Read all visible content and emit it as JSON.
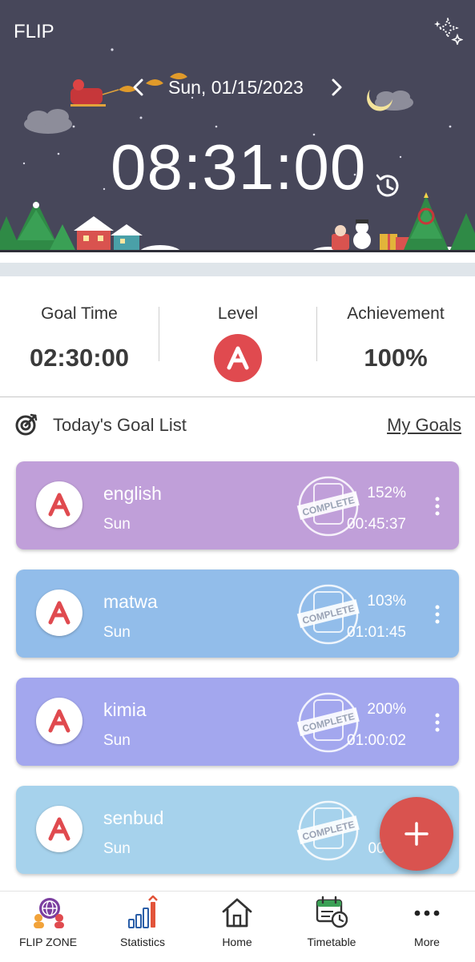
{
  "header": {
    "app_title": "FLIP",
    "date": "Sun, 01/15/2023",
    "clock": "08:31:00"
  },
  "stats": {
    "goal_time_label": "Goal Time",
    "goal_time_value": "02:30:00",
    "level_label": "Level",
    "level_value": "A",
    "achievement_label": "Achievement",
    "achievement_value": "100%"
  },
  "goal_list": {
    "title": "Today's Goal List",
    "my_goals_link": "My Goals",
    "stamp_text": "COMPLETE",
    "items": [
      {
        "name": "english",
        "day": "Sun",
        "percent": "152%",
        "time": "00:45:37",
        "color": "#c09fd9",
        "grade": "A"
      },
      {
        "name": "matwa",
        "day": "Sun",
        "percent": "103%",
        "time": "01:01:45",
        "color": "#92bdea",
        "grade": "A"
      },
      {
        "name": "kimia",
        "day": "Sun",
        "percent": "200%",
        "time": "01:00:02",
        "color": "#a3a7ee",
        "grade": "A"
      },
      {
        "name": "senbud",
        "day": "Sun",
        "percent": "14",
        "time": "00:42",
        "color": "#a6d2ec",
        "grade": "A"
      }
    ]
  },
  "bottom_nav": {
    "items": [
      {
        "label": "FLIP ZONE",
        "icon": "flip-zone-icon"
      },
      {
        "label": "Statistics",
        "icon": "statistics-icon"
      },
      {
        "label": "Home",
        "icon": "home-icon"
      },
      {
        "label": "Timetable",
        "icon": "timetable-icon"
      },
      {
        "label": "More",
        "icon": "more-icon"
      }
    ]
  },
  "colors": {
    "header_bg": "#47475a",
    "accent_red": "#e04a4f",
    "fab": "#d9534f"
  }
}
